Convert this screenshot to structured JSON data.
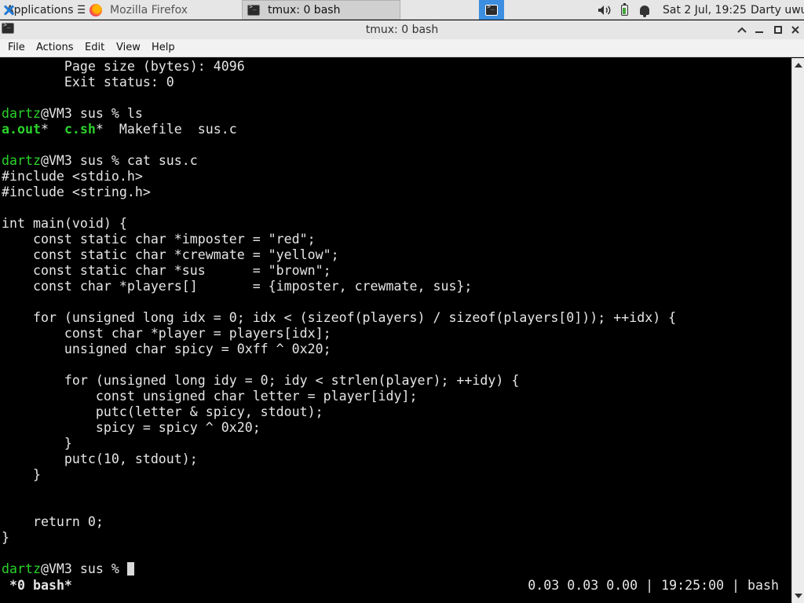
{
  "panel": {
    "apps_label": "Applications ☰",
    "tasks": [
      {
        "label": "Mozilla Firefox",
        "icon": "firefox-icon"
      },
      {
        "label": "tmux: 0 bash",
        "icon": "terminal-icon"
      }
    ],
    "clock": "Sat  2 Jul, 19:25",
    "user": "Darty uwu",
    "accent_color": "#3b8ee0"
  },
  "window": {
    "title": "tmux: 0 bash",
    "controls": [
      "chevron-up-icon",
      "minimize-icon",
      "maximize-icon",
      "close-icon"
    ]
  },
  "menu": [
    "File",
    "Actions",
    "Edit",
    "View",
    "Help"
  ],
  "terminal": {
    "lines": [
      "        Page size (bytes): 4096",
      "        Exit status: 0",
      "",
      "",
      "a.out*  c.sh*  Makefile  sus.c",
      "",
      "",
      "#include <stdio.h>",
      "#include <string.h>",
      "",
      "int main(void) {",
      "    const static char *imposter = \"red\";",
      "    const static char *crewmate = \"yellow\";",
      "    const static char *sus      = \"brown\";",
      "    const char *players[]       = {imposter, crewmate, sus};",
      "",
      "    for (unsigned long idx = 0; idx < (sizeof(players) / sizeof(players[0])); ++idx) {",
      "        const char *player = players[idx];",
      "        unsigned char spicy = 0xff ^ 0x20;",
      "",
      "        for (unsigned long idy = 0; idy < strlen(player); ++idy) {",
      "            const unsigned char letter = player[idy];",
      "            putc(letter & spicy, stdout);",
      "            spicy = spicy ^ 0x20;",
      "        }",
      "        putc(10, stdout);",
      "    }",
      "",
      "",
      "    return 0;",
      "}",
      "",
      ""
    ],
    "prompt_user": "dartz",
    "prompt_rest": "@VM3 sus % ",
    "cmd_ls": "ls",
    "cmd_cat": "cat sus.c",
    "ls_items": {
      "a_out": "a.out",
      "star1": "*  ",
      "c_sh": "c.sh",
      "rest": "*  Makefile  sus.c"
    },
    "status_left": "*0 bash*",
    "status_right": "0.03 0.03 0.00 | 19:25:00 | bash",
    "prompt_color": "#2bd22b"
  }
}
